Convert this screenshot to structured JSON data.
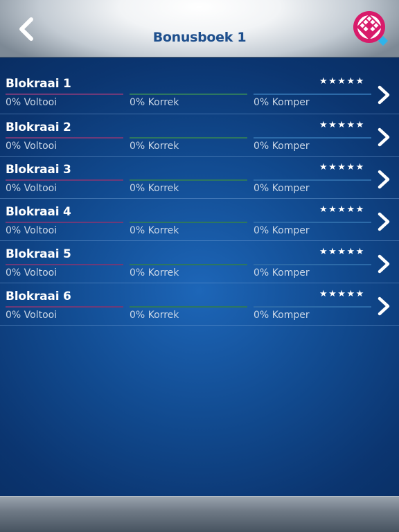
{
  "header": {
    "title": "Bonusboek 1",
    "back_icon": "chevron-left-icon",
    "logo_icon": "puzzle-logo-icon"
  },
  "colors": {
    "title": "#1e4f8d",
    "voltooi_bar": "#6e3a78",
    "korrek_bar": "#2d7760",
    "komper_bar": "#2c6aa8",
    "logo_pink": "#d81b6a"
  },
  "puzzles": [
    {
      "name": "Blokraai 1",
      "rating": "★★★★★",
      "voltooi": "0% Voltooi",
      "korrek": "0% Korrek",
      "komper": "0% Komper"
    },
    {
      "name": "Blokraai 2",
      "rating": "★★★★★",
      "voltooi": "0% Voltooi",
      "korrek": "0% Korrek",
      "komper": "0% Komper"
    },
    {
      "name": "Blokraai 3",
      "rating": "★★★★★",
      "voltooi": "0% Voltooi",
      "korrek": "0% Korrek",
      "komper": "0% Komper"
    },
    {
      "name": "Blokraai 4",
      "rating": "★★★★★",
      "voltooi": "0% Voltooi",
      "korrek": "0% Korrek",
      "komper": "0% Komper"
    },
    {
      "name": "Blokraai 5",
      "rating": "★★★★★",
      "voltooi": "0% Voltooi",
      "korrek": "0% Korrek",
      "komper": "0% Komper"
    },
    {
      "name": "Blokraai 6",
      "rating": "★★★★★",
      "voltooi": "0% Voltooi",
      "korrek": "0% Korrek",
      "komper": "0% Komper"
    }
  ]
}
